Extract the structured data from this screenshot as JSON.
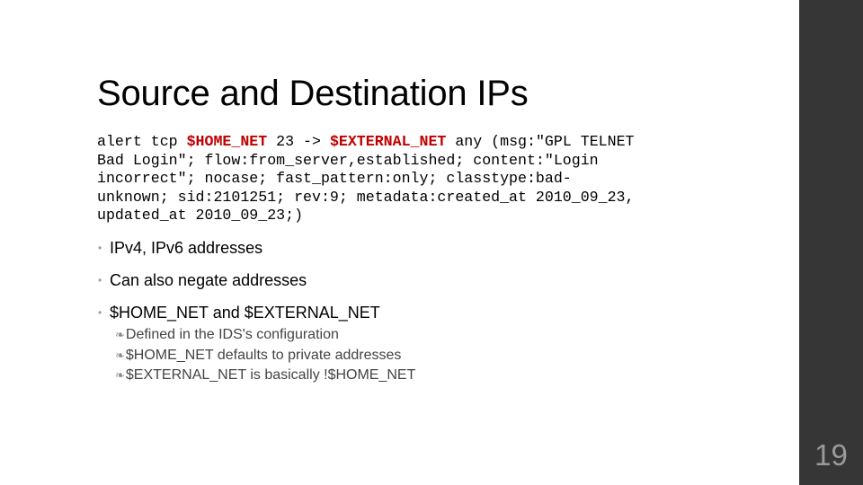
{
  "slide": {
    "title": "Source and Destination IPs",
    "page_number": "19",
    "accent_color": "#c00000",
    "sidebar_color": "#363636",
    "code": {
      "lines": [
        [
          {
            "text": "alert tcp ",
            "hl": false
          },
          {
            "text": "$HOME_NET",
            "hl": true
          },
          {
            "text": " 23 -> ",
            "hl": false
          },
          {
            "text": "$EXTERNAL_NET",
            "hl": true
          },
          {
            "text": " any (msg:\"GPL TELNET",
            "hl": false
          }
        ],
        [
          {
            "text": "Bad Login\"; flow:from_server,established; content:\"Login",
            "hl": false
          }
        ],
        [
          {
            "text": "incorrect\"; nocase; fast_pattern:only; classtype:bad-",
            "hl": false
          }
        ],
        [
          {
            "text": "unknown; sid:2101251; rev:9; metadata:created_at 2010_09_23,",
            "hl": false
          }
        ],
        [
          {
            "text": "updated_at 2010_09_23;)",
            "hl": false
          }
        ]
      ]
    },
    "bullets": [
      {
        "text": "IPv4, IPv6 addresses",
        "icon": "bullet-dot"
      },
      {
        "text": "Can also negate addresses",
        "icon": "bullet-dot"
      },
      {
        "text": "$HOME_NET and $EXTERNAL_NET",
        "icon": "bullet-dot"
      }
    ],
    "sub_bullets": [
      {
        "text": "Defined in the IDS's configuration",
        "icon": "fleuron-bullet"
      },
      {
        "text": "$HOME_NET defaults to private addresses",
        "icon": "fleuron-bullet"
      },
      {
        "text": "$EXTERNAL_NET is basically !$HOME_NET",
        "icon": "fleuron-bullet"
      }
    ]
  }
}
